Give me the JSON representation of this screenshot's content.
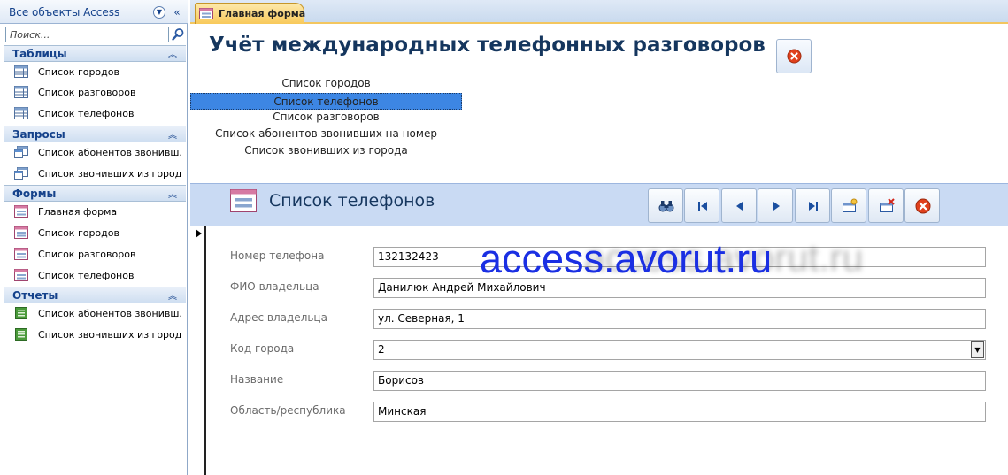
{
  "nav": {
    "title": "Все объекты Access",
    "menu_icon": "chevron-circle-down-icon",
    "collapse_icon": "double-chevron-left-icon",
    "search_placeholder": "Поиск...",
    "groups": [
      {
        "title": "Таблицы",
        "icon": "table-icon",
        "items": [
          "Список городов",
          "Список разговоров",
          "Список телефонов"
        ]
      },
      {
        "title": "Запросы",
        "icon": "query-icon",
        "items": [
          "Список абонентов звонивш...",
          "Список звонивших из города"
        ]
      },
      {
        "title": "Формы",
        "icon": "form-icon",
        "items": [
          "Главная форма",
          "Список городов",
          "Список разговоров",
          "Список телефонов"
        ]
      },
      {
        "title": "Отчеты",
        "icon": "report-icon",
        "items": [
          "Список абонентов звонивш...",
          "Список звонивших из города"
        ]
      }
    ]
  },
  "tabs": [
    {
      "label": "Главная форма",
      "active": true
    }
  ],
  "main": {
    "title": "Учёт международных телефонных разговоров",
    "list": [
      {
        "label": "Список городов",
        "selected": false
      },
      {
        "label": "Список телефонов",
        "selected": true
      },
      {
        "label": "Список разговоров",
        "selected": false
      },
      {
        "label": "Список абонентов звонивших на номер",
        "selected": false
      },
      {
        "label": "Список звонивших из города",
        "selected": false
      }
    ]
  },
  "subform": {
    "title": "Список телефонов",
    "toolbar": [
      "find-icon",
      "first-record-icon",
      "previous-record-icon",
      "next-record-icon",
      "last-record-icon",
      "new-record-icon",
      "delete-record-icon",
      "close-icon"
    ],
    "fields": [
      {
        "label": "Номер телефона",
        "value": "132132423"
      },
      {
        "label": "ФИО владельца",
        "value": "Данилюк Андрей Михайлович"
      },
      {
        "label": "Адрес владельца",
        "value": "ул. Северная, 1"
      },
      {
        "label": "Код города",
        "value": "2"
      },
      {
        "label": "Название",
        "value": "Борисов"
      },
      {
        "label": "Область/республика",
        "value": "Минская"
      }
    ]
  },
  "watermark": "access.avorut.ru",
  "colors": {
    "accent": "#15428b",
    "title": "#15365e",
    "selection": "#3d86e3",
    "tab": "#f8c95a",
    "watermark": "#1a2fe3"
  }
}
